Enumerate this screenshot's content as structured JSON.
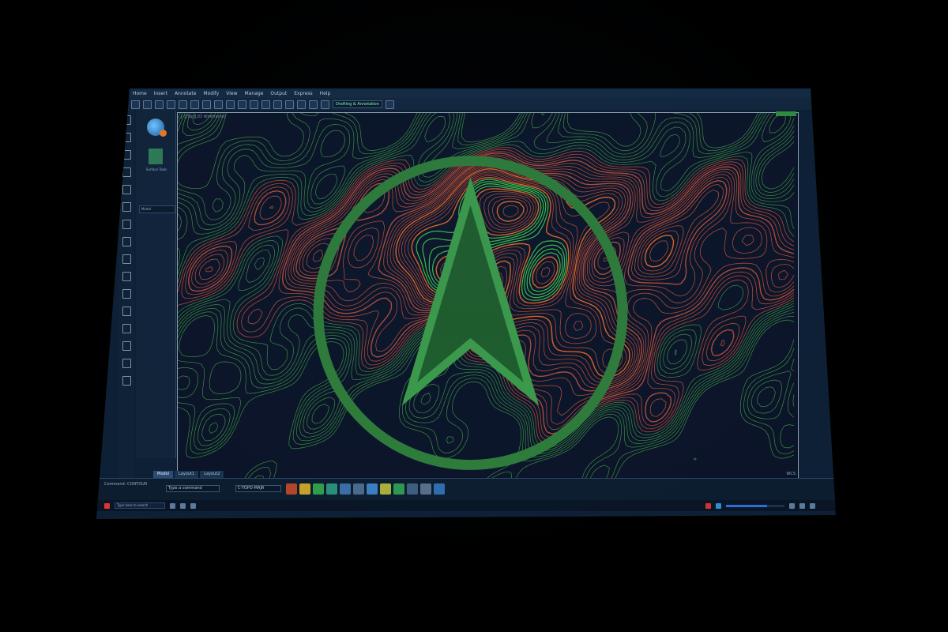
{
  "menu": [
    "Home",
    "Insert",
    "Annotate",
    "Modify",
    "View",
    "Manage",
    "Output",
    "Express",
    "Help"
  ],
  "toolbar": {
    "workspace_value": "Drafting & Annotation"
  },
  "palette": {
    "caption": "Surface Tools",
    "field_value": "Model"
  },
  "viewport": {
    "label": "[-][Top][2D Wireframe]",
    "corner_label": "WCS"
  },
  "layout_tabs": [
    "Model",
    "Layout1",
    "Layout2"
  ],
  "command": {
    "history": "Command: CONTOUR",
    "prompt_value": "Type a command",
    "layer_value": "C-TOPO-MAJR"
  },
  "status": {
    "search_placeholder": "Type here to search",
    "progress": 0.7
  },
  "colors": {
    "minor_contour": "#b24a35",
    "major_contour": "#e8641e",
    "green_contour": "#3cbf4a",
    "accent_blue": "#2b6fd6"
  }
}
